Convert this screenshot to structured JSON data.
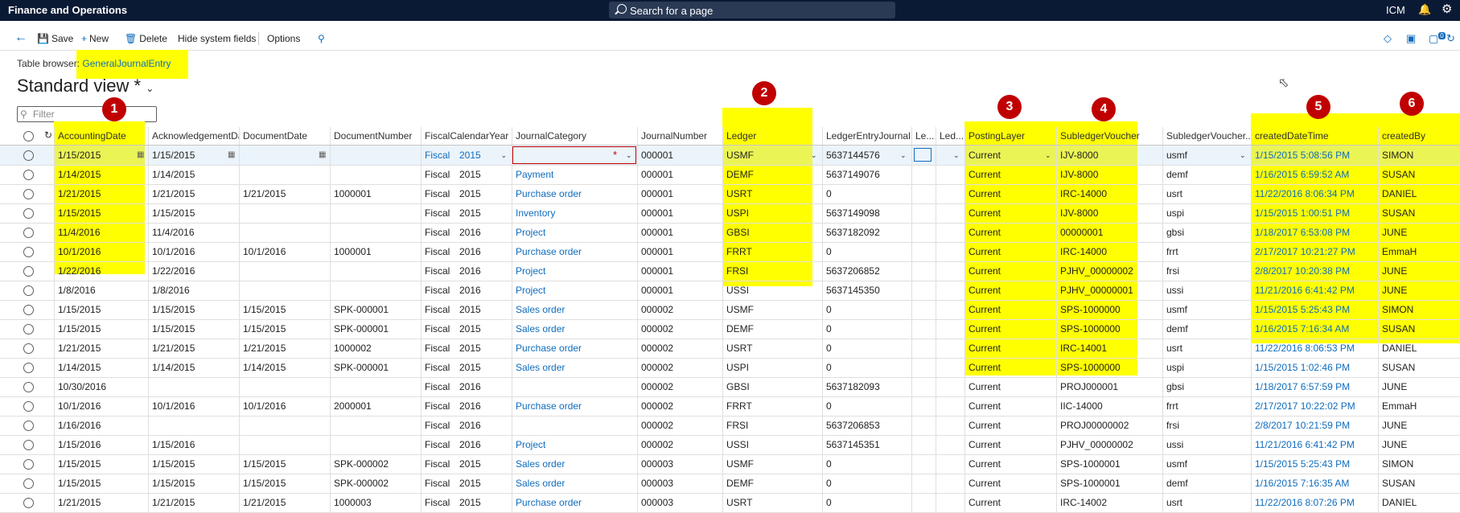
{
  "app": {
    "title": "Finance and Operations",
    "search_placeholder": "Search for a page",
    "user": "ICM"
  },
  "toolbar": {
    "save": "Save",
    "new": "New",
    "delete": "Delete",
    "hide_system_fields": "Hide system fields",
    "options": "Options",
    "badge_count": "0"
  },
  "page": {
    "table_browser_label": "Table browser:",
    "table_name": "GeneralJournalEntry",
    "view_name": "Standard view *",
    "filter_placeholder": "Filter"
  },
  "badges": [
    "1",
    "2",
    "3",
    "4",
    "5",
    "6"
  ],
  "highlight_color": "#ffff00",
  "badge_color": "#c00000",
  "columns": [
    "AccountingDate",
    "AcknowledgementDate",
    "DocumentDate",
    "DocumentNumber",
    "FiscalCalendarYear",
    "JournalCategory",
    "JournalNumber",
    "Ledger",
    "LedgerEntryJournal",
    "Le...",
    "Led...",
    "PostingLayer",
    "SubledgerVoucher",
    "SubledgerVoucher...",
    "createdDateTime",
    "createdBy"
  ],
  "rows": [
    [
      "1/15/2015",
      "1/15/2015",
      "",
      "",
      "Fiscal",
      "2015",
      "",
      "000001",
      "USMF",
      "5637144576",
      "",
      "",
      "Current",
      "IJV-8000",
      "usmf",
      "1/15/2015 5:08:56 PM",
      "SIMON"
    ],
    [
      "1/14/2015",
      "1/14/2015",
      "",
      "",
      "Fiscal",
      "2015",
      "Payment",
      "000001",
      "DEMF",
      "5637149076",
      "",
      "",
      "Current",
      "IJV-8000",
      "demf",
      "1/16/2015 6:59:52 AM",
      "SUSAN"
    ],
    [
      "1/21/2015",
      "1/21/2015",
      "1/21/2015",
      "1000001",
      "Fiscal",
      "2015",
      "Purchase order",
      "000001",
      "USRT",
      "0",
      "",
      "",
      "Current",
      "IRC-14000",
      "usrt",
      "11/22/2016 8:06:34 PM",
      "DANIEL"
    ],
    [
      "1/15/2015",
      "1/15/2015",
      "",
      "",
      "Fiscal",
      "2015",
      "Inventory",
      "000001",
      "USPI",
      "5637149098",
      "",
      "",
      "Current",
      "IJV-8000",
      "uspi",
      "1/15/2015 1:00:51 PM",
      "SUSAN"
    ],
    [
      "11/4/2016",
      "11/4/2016",
      "",
      "",
      "Fiscal",
      "2016",
      "Project",
      "000001",
      "GBSI",
      "5637182092",
      "",
      "",
      "Current",
      "00000001",
      "gbsi",
      "1/18/2017 6:53:08 PM",
      "JUNE"
    ],
    [
      "10/1/2016",
      "10/1/2016",
      "10/1/2016",
      "1000001",
      "Fiscal",
      "2016",
      "Purchase order",
      "000001",
      "FRRT",
      "0",
      "",
      "",
      "Current",
      "IRC-14000",
      "frrt",
      "2/17/2017 10:21:27 PM",
      "EmmaH"
    ],
    [
      "1/22/2016",
      "1/22/2016",
      "",
      "",
      "Fiscal",
      "2016",
      "Project",
      "000001",
      "FRSI",
      "5637206852",
      "",
      "",
      "Current",
      "PJHV_00000002",
      "frsi",
      "2/8/2017 10:20:38 PM",
      "JUNE"
    ],
    [
      "1/8/2016",
      "1/8/2016",
      "",
      "",
      "Fiscal",
      "2016",
      "Project",
      "000001",
      "USSI",
      "5637145350",
      "",
      "",
      "Current",
      "PJHV_00000001",
      "ussi",
      "11/21/2016 6:41:42 PM",
      "JUNE"
    ],
    [
      "1/15/2015",
      "1/15/2015",
      "1/15/2015",
      "SPK-000001",
      "Fiscal",
      "2015",
      "Sales order",
      "000002",
      "USMF",
      "0",
      "",
      "",
      "Current",
      "SPS-1000000",
      "usmf",
      "1/15/2015 5:25:43 PM",
      "SIMON"
    ],
    [
      "1/15/2015",
      "1/15/2015",
      "1/15/2015",
      "SPK-000001",
      "Fiscal",
      "2015",
      "Sales order",
      "000002",
      "DEMF",
      "0",
      "",
      "",
      "Current",
      "SPS-1000000",
      "demf",
      "1/16/2015 7:16:34 AM",
      "SUSAN"
    ],
    [
      "1/21/2015",
      "1/21/2015",
      "1/21/2015",
      "1000002",
      "Fiscal",
      "2015",
      "Purchase order",
      "000002",
      "USRT",
      "0",
      "",
      "",
      "Current",
      "IRC-14001",
      "usrt",
      "11/22/2016 8:06:53 PM",
      "DANIEL"
    ],
    [
      "1/14/2015",
      "1/14/2015",
      "1/14/2015",
      "SPK-000001",
      "Fiscal",
      "2015",
      "Sales order",
      "000002",
      "USPI",
      "0",
      "",
      "",
      "Current",
      "SPS-1000000",
      "uspi",
      "1/15/2015 1:02:46 PM",
      "SUSAN"
    ],
    [
      "10/30/2016",
      "",
      "",
      "",
      "Fiscal",
      "2016",
      "",
      "000002",
      "GBSI",
      "5637182093",
      "",
      "",
      "Current",
      "PROJ000001",
      "gbsi",
      "1/18/2017 6:57:59 PM",
      "JUNE"
    ],
    [
      "10/1/2016",
      "10/1/2016",
      "10/1/2016",
      "2000001",
      "Fiscal",
      "2016",
      "Purchase order",
      "000002",
      "FRRT",
      "0",
      "",
      "",
      "Current",
      "IIC-14000",
      "frrt",
      "2/17/2017 10:22:02 PM",
      "EmmaH"
    ],
    [
      "1/16/2016",
      "",
      "",
      "",
      "Fiscal",
      "2016",
      "",
      "000002",
      "FRSI",
      "5637206853",
      "",
      "",
      "Current",
      "PROJ00000002",
      "frsi",
      "2/8/2017 10:21:59 PM",
      "JUNE"
    ],
    [
      "1/15/2016",
      "1/15/2016",
      "",
      "",
      "Fiscal",
      "2016",
      "Project",
      "000002",
      "USSI",
      "5637145351",
      "",
      "",
      "Current",
      "PJHV_00000002",
      "ussi",
      "11/21/2016 6:41:42 PM",
      "JUNE"
    ],
    [
      "1/15/2015",
      "1/15/2015",
      "1/15/2015",
      "SPK-000002",
      "Fiscal",
      "2015",
      "Sales order",
      "000003",
      "USMF",
      "0",
      "",
      "",
      "Current",
      "SPS-1000001",
      "usmf",
      "1/15/2015 5:25:43 PM",
      "SIMON"
    ],
    [
      "1/15/2015",
      "1/15/2015",
      "1/15/2015",
      "SPK-000002",
      "Fiscal",
      "2015",
      "Sales order",
      "000003",
      "DEMF",
      "0",
      "",
      "",
      "Current",
      "SPS-1000001",
      "demf",
      "1/16/2015 7:16:35 AM",
      "SUSAN"
    ],
    [
      "1/21/2015",
      "1/21/2015",
      "1/21/2015",
      "1000003",
      "Fiscal",
      "2015",
      "Purchase order",
      "000003",
      "USRT",
      "0",
      "",
      "",
      "Current",
      "IRC-14002",
      "usrt",
      "11/22/2016 8:07:26 PM",
      "DANIEL"
    ]
  ]
}
